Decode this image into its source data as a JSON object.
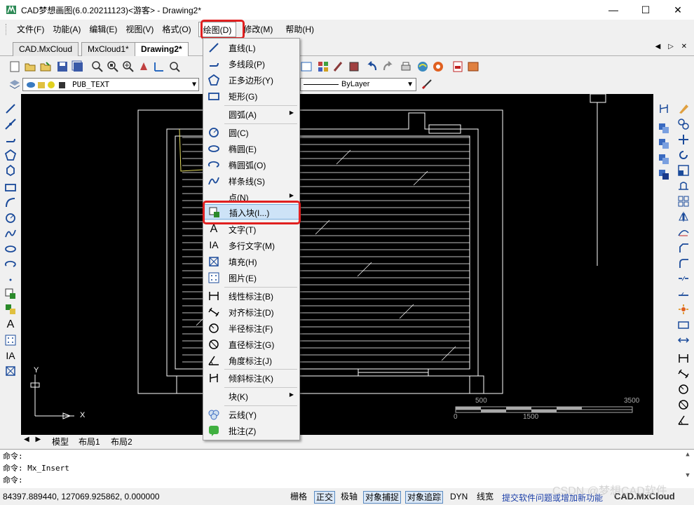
{
  "window": {
    "title": "CAD梦想画图(6.0.20211123)<游客> - Drawing2*",
    "minimize": "—",
    "maximize": "☐",
    "close": "✕"
  },
  "menu": [
    {
      "label": "文件(F)"
    },
    {
      "label": "功能(A)"
    },
    {
      "label": "编辑(E)"
    },
    {
      "label": "视图(V)"
    },
    {
      "label": "格式(O)"
    },
    {
      "label": "绘图(D)"
    },
    {
      "label": "修改(M)"
    },
    {
      "label": "帮助(H)"
    }
  ],
  "tabs": [
    {
      "label": "CAD.MxCloud"
    },
    {
      "label": "MxCloud1*"
    },
    {
      "label": "Drawing2*"
    }
  ],
  "tab_arrows": "◀ ▷ ✕",
  "toolbar": {
    "layer_name": "PUB_TEXT",
    "linetype": "ByLayer"
  },
  "draw_menu": {
    "items": [
      {
        "label": "直线(L)",
        "icon": "line-icon"
      },
      {
        "label": "多线段(P)",
        "icon": "polyline-icon"
      },
      {
        "label": "正多边形(Y)",
        "icon": "polygon-icon"
      },
      {
        "label": "矩形(G)",
        "icon": "rectangle-icon"
      },
      {
        "label": "圆弧(A)",
        "icon": "",
        "submenu": true
      },
      {
        "label": "圆(C)",
        "icon": "circle-icon"
      },
      {
        "label": "椭圆(E)",
        "icon": "ellipse-icon"
      },
      {
        "label": "椭圆弧(O)",
        "icon": "ellipse-arc-icon"
      },
      {
        "label": "样条线(S)",
        "icon": "spline-icon"
      },
      {
        "label": "点(N)",
        "icon": "",
        "submenu": true
      },
      {
        "label": "插入块(I...)",
        "icon": "insert-block-icon"
      },
      {
        "label": "文字(T)",
        "icon": "text-icon"
      },
      {
        "label": "多行文字(M)",
        "icon": "mtext-icon"
      },
      {
        "label": "填充(H)",
        "icon": "hatch-icon"
      },
      {
        "label": "图片(E)",
        "icon": "image-icon"
      },
      {
        "label": "线性标注(B)",
        "icon": "linear-dim-icon"
      },
      {
        "label": "对齐标注(D)",
        "icon": "aligned-dim-icon"
      },
      {
        "label": "半径标注(F)",
        "icon": "radius-dim-icon"
      },
      {
        "label": "直径标注(G)",
        "icon": "diameter-dim-icon"
      },
      {
        "label": "角度标注(J)",
        "icon": "angle-dim-icon"
      },
      {
        "label": "倾斜标注(K)",
        "icon": "oblique-dim-icon"
      },
      {
        "label": "块(K)",
        "icon": "",
        "submenu": true
      },
      {
        "label": "云线(Y)",
        "icon": "revcloud-icon"
      },
      {
        "label": "批注(Z)",
        "icon": "annotation-icon"
      }
    ],
    "highlighted": "插入块(I...)"
  },
  "canvas": {
    "ucs_x": "X",
    "ucs_y": "Y",
    "scale_labels": [
      "500",
      "3500",
      "0",
      "1500"
    ]
  },
  "layout_tabs": [
    {
      "label": "模型"
    },
    {
      "label": "布局1"
    },
    {
      "label": "布局2"
    }
  ],
  "command": {
    "line1": "命令:",
    "line2": "命令:  Mx_Insert",
    "line3": "命令:"
  },
  "status": {
    "coords": "84397.889440,  127069.925862,  0.000000",
    "buttons": [
      {
        "label": "栅格",
        "on": false
      },
      {
        "label": "正交",
        "on": true
      },
      {
        "label": "极轴",
        "on": false
      },
      {
        "label": "对象捕捉",
        "on": true
      },
      {
        "label": "对象追踪",
        "on": true
      },
      {
        "label": "DYN",
        "on": false
      },
      {
        "label": "线宽",
        "on": false
      }
    ],
    "link": "提交软件问题或增加新功能",
    "brand": "CAD.MxCloud",
    "watermark": "CSDN @梦想CAD软件"
  },
  "colors": {
    "highlight_box": "#e02020",
    "canvas_bg": "#000000",
    "menu_hover": "#cde3f7"
  }
}
